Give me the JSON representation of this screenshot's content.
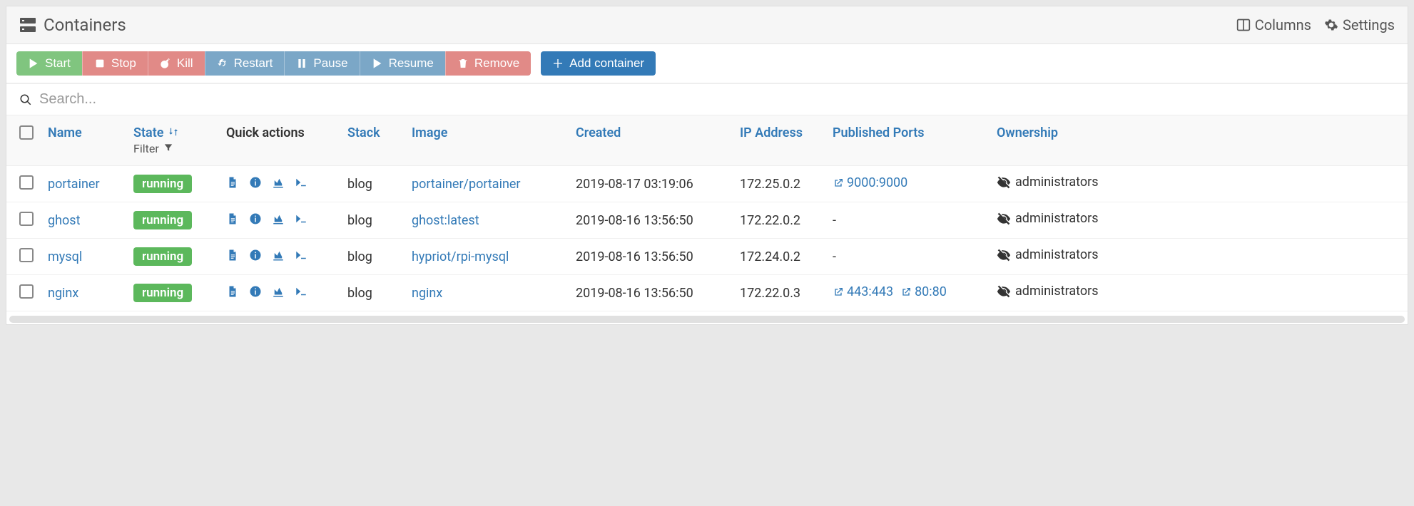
{
  "header": {
    "title": "Containers",
    "columns_label": "Columns",
    "settings_label": "Settings"
  },
  "toolbar": {
    "start": "Start",
    "stop": "Stop",
    "kill": "Kill",
    "restart": "Restart",
    "pause": "Pause",
    "resume": "Resume",
    "remove": "Remove",
    "add": "Add container"
  },
  "search": {
    "placeholder": "Search..."
  },
  "columns": {
    "name": "Name",
    "state": "State",
    "state_filter": "Filter",
    "quick_actions": "Quick actions",
    "stack": "Stack",
    "image": "Image",
    "created": "Created",
    "ip": "IP Address",
    "ports": "Published Ports",
    "ownership": "Ownership"
  },
  "rows": [
    {
      "name": "portainer",
      "state": "running",
      "stack": "blog",
      "image": "portainer/portainer",
      "created": "2019-08-17 03:19:06",
      "ip": "172.25.0.2",
      "ports": [
        {
          "label": "9000:9000"
        }
      ],
      "ownership": "administrators"
    },
    {
      "name": "ghost",
      "state": "running",
      "stack": "blog",
      "image": "ghost:latest",
      "created": "2019-08-16 13:56:50",
      "ip": "172.22.0.2",
      "ports": [],
      "ports_empty": "-",
      "ownership": "administrators"
    },
    {
      "name": "mysql",
      "state": "running",
      "stack": "blog",
      "image": "hypriot/rpi-mysql",
      "created": "2019-08-16 13:56:50",
      "ip": "172.24.0.2",
      "ports": [],
      "ports_empty": "-",
      "ownership": "administrators"
    },
    {
      "name": "nginx",
      "state": "running",
      "stack": "blog",
      "image": "nginx",
      "created": "2019-08-16 13:56:50",
      "ip": "172.22.0.3",
      "ports": [
        {
          "label": "443:443"
        },
        {
          "label": "80:80"
        }
      ],
      "ownership": "administrators"
    }
  ]
}
